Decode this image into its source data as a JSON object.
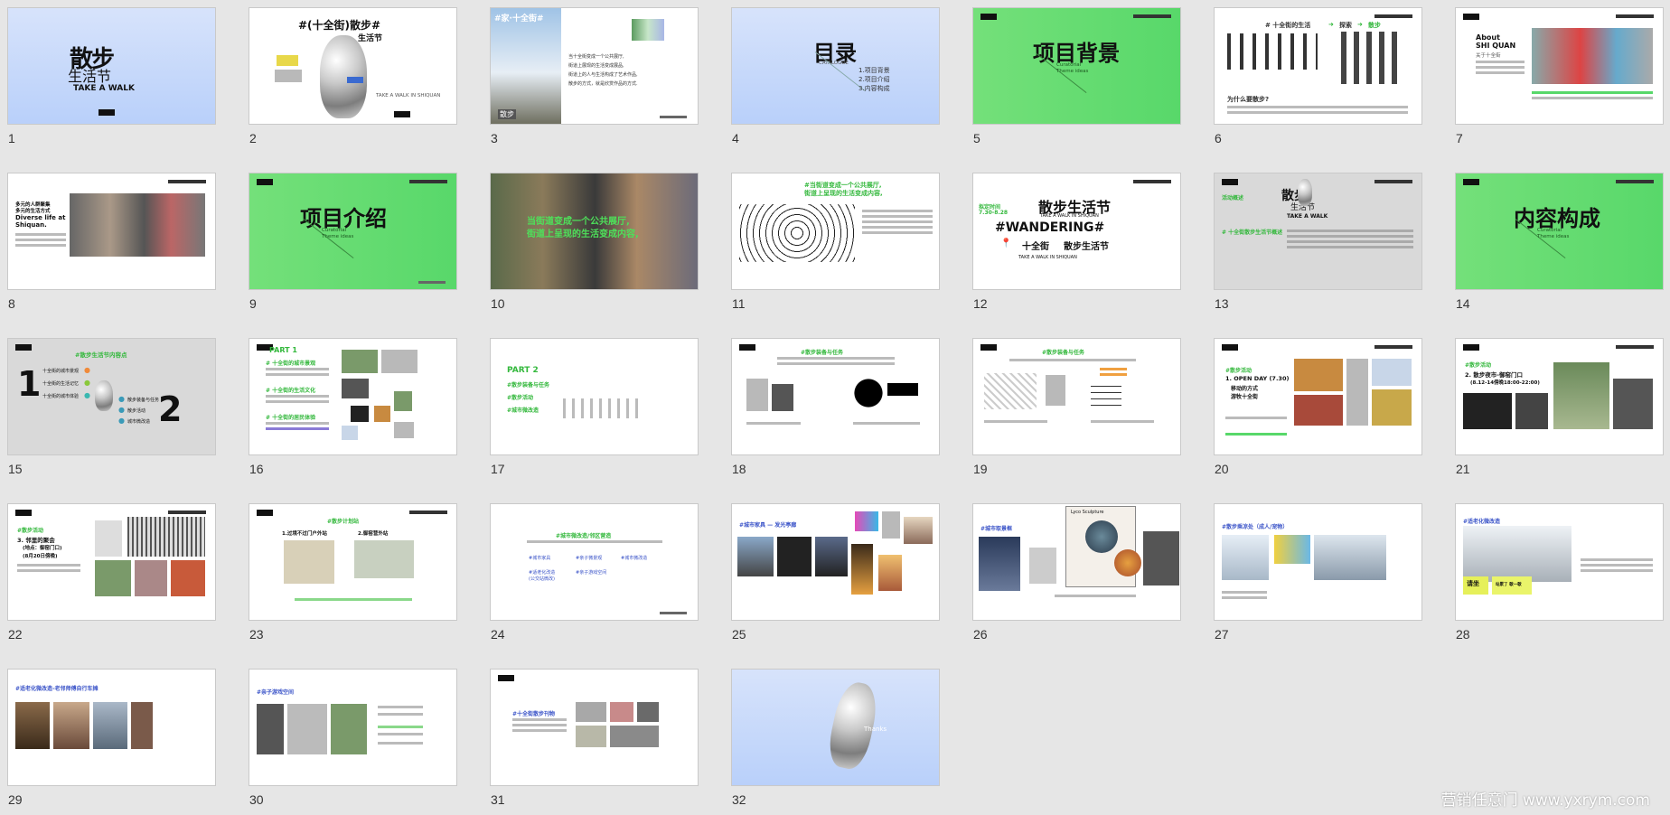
{
  "slides": [
    {
      "num": "1",
      "bg": "blue",
      "lines": [
        "散步",
        "生活节",
        "TAKE A WALK"
      ]
    },
    {
      "num": "2",
      "bg": "white",
      "lines": [
        "#(十全街)散步#",
        "生活节",
        "TAKE A WALK IN SHIQUAN"
      ]
    },
    {
      "num": "3",
      "bg": "white",
      "lines": [
        "#家·十全街#",
        "当十全街变成一个公共展厅,",
        "街道上展现的生活变成展品,",
        "街道上的人与生活构成了艺术作品,",
        "散步的方式，就是欣赏作品的方式.",
        "散步"
      ]
    },
    {
      "num": "4",
      "bg": "blue",
      "lines": [
        "目录",
        "CATALOGUE",
        "1.项目背景",
        "2.项目介绍",
        "3.内容构成"
      ]
    },
    {
      "num": "5",
      "bg": "green",
      "lines": [
        "项目背景",
        "Curatorial",
        "Theme ideas"
      ]
    },
    {
      "num": "6",
      "bg": "white",
      "lines": [
        "# 十全街的生活",
        "探索",
        "散步",
        "为什么要散步?"
      ]
    },
    {
      "num": "7",
      "bg": "white",
      "lines": [
        "About",
        "SHI QUAN",
        "关于十全街"
      ]
    },
    {
      "num": "8",
      "bg": "white",
      "lines": [
        "多元的人群聚集",
        "多元的生活方式",
        "Diverse life at",
        "Shiquan."
      ]
    },
    {
      "num": "9",
      "bg": "green",
      "lines": [
        "项目介绍",
        "Curatorial",
        "Theme ideas"
      ]
    },
    {
      "num": "10",
      "bg": "white",
      "lines": [
        "当街道变成一个公共展厅,",
        "街道上呈现的生活变成内容,"
      ]
    },
    {
      "num": "11",
      "bg": "white",
      "lines": [
        "#当街道变成一个公共展厅,",
        "街道上呈现的生活变成内容,"
      ]
    },
    {
      "num": "12",
      "bg": "white",
      "lines": [
        "散步生活节",
        "拟定时间",
        "7.30-8.28",
        "TAKE A WALK IN SHIQUAN",
        "#WANDERING#",
        "十全街",
        "散步生活节",
        "TAKE A WALK IN SHIQUAN"
      ]
    },
    {
      "num": "13",
      "bg": "gray",
      "lines": [
        "活动概述",
        "散步",
        "生活节",
        "TAKE A WALK",
        "# 十全街散步生活节概述"
      ]
    },
    {
      "num": "14",
      "bg": "green",
      "lines": [
        "内容构成",
        "Curatorial",
        "Theme ideas"
      ]
    },
    {
      "num": "15",
      "bg": "gray",
      "lines": [
        "#散步生活节内容点",
        "1",
        "十全街的城市景观",
        "十全街的生活记忆",
        "十全街的城市体验",
        "散步装备与任务",
        "散步活动",
        "城市微改造",
        "2"
      ]
    },
    {
      "num": "16",
      "bg": "white",
      "lines": [
        "PART 1",
        "# 十全街的城市景观",
        "# 十全街的生活文化",
        "# 十全街的居民体验"
      ]
    },
    {
      "num": "17",
      "bg": "white",
      "lines": [
        "PART 2",
        "#散步装备与任务",
        "#散步活动",
        "#城市微改造"
      ]
    },
    {
      "num": "18",
      "bg": "white",
      "lines": [
        "#散步装备与任务"
      ]
    },
    {
      "num": "19",
      "bg": "white",
      "lines": [
        "#散步装备与任务"
      ]
    },
    {
      "num": "20",
      "bg": "white",
      "lines": [
        "#散步活动",
        "1. OPEN DAY (7.30)",
        "移动的方式",
        "游牧十全街"
      ]
    },
    {
      "num": "21",
      "bg": "white",
      "lines": [
        "#散步活动",
        "2. 散步夜市-御窑门口",
        "(8.12-14傍晚18:00-22:00)"
      ]
    },
    {
      "num": "22",
      "bg": "white",
      "lines": [
        "#散步活动",
        "3. 邻里的聚会",
        "(地点：御窑门口)",
        "(8月20日傍晚)"
      ]
    },
    {
      "num": "23",
      "bg": "white",
      "lines": [
        "#散步计划站",
        "1.过境不过门户外站",
        "2.御窑营外站"
      ]
    },
    {
      "num": "24",
      "bg": "white",
      "lines": [
        "#城市微改造/邻区营造",
        "#城市家具",
        "#亲子微景观",
        "#城市微改造",
        "#适老化改造",
        "(公交站微改)",
        "#亲子游戏空间"
      ]
    },
    {
      "num": "25",
      "bg": "white",
      "lines": [
        "#城市家具 — 发光亭廊"
      ]
    },
    {
      "num": "26",
      "bg": "white",
      "lines": [
        "#城市取景框",
        "Lyco Sculpture"
      ]
    },
    {
      "num": "27",
      "bg": "white",
      "lines": [
        "#散步乘凉处（成人/宠物）"
      ]
    },
    {
      "num": "28",
      "bg": "white",
      "lines": [
        "#适老化微改造",
        "请坐",
        "站累了 歇一歇"
      ]
    },
    {
      "num": "29",
      "bg": "white",
      "lines": [
        "#适老化微改造-老邻师傅自行车摊"
      ]
    },
    {
      "num": "30",
      "bg": "white",
      "lines": [
        "#亲子游戏空间"
      ]
    },
    {
      "num": "31",
      "bg": "white",
      "lines": [
        "#十全街散步刊物"
      ]
    },
    {
      "num": "32",
      "bg": "blue",
      "lines": [
        "Thanks"
      ]
    }
  ],
  "watermark": "营销任意门 www.yxrym.com",
  "colors": {
    "accent_green": "#33b83c",
    "accent_blue": "#3a53c8",
    "bg": "#e6e6e6"
  }
}
